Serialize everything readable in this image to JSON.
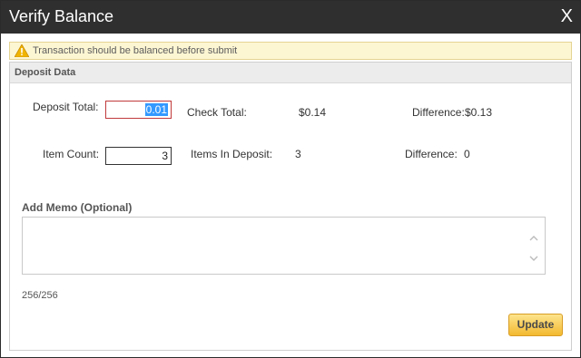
{
  "dialog": {
    "title": "Verify Balance",
    "close_label": "X"
  },
  "warning": {
    "icon": "warning-triangle-icon",
    "text": "Transaction should be balanced before submit"
  },
  "panel": {
    "header": "Deposit Data"
  },
  "deposit": {
    "deposit_total_label": "Deposit Total:",
    "deposit_total_value": "0.01",
    "check_total_label": "Check Total:",
    "check_total_value": "$0.14",
    "difference_label": "Difference:",
    "difference_value": "$0.13"
  },
  "items": {
    "item_count_label": "Item Count:",
    "item_count_value": "3",
    "items_in_deposit_label": "Items In Deposit:",
    "items_in_deposit_value": "3",
    "difference_label": "Difference:",
    "difference_value": "0"
  },
  "memo": {
    "label": "Add Memo (Optional)",
    "value": "",
    "counter": "256/256"
  },
  "actions": {
    "update_label": "Update"
  },
  "colors": {
    "titlebar": "#2f2f2f",
    "warning_bg": "#fdf6d3",
    "button": "#f3b92f",
    "invalid_border": "#c0393b"
  }
}
